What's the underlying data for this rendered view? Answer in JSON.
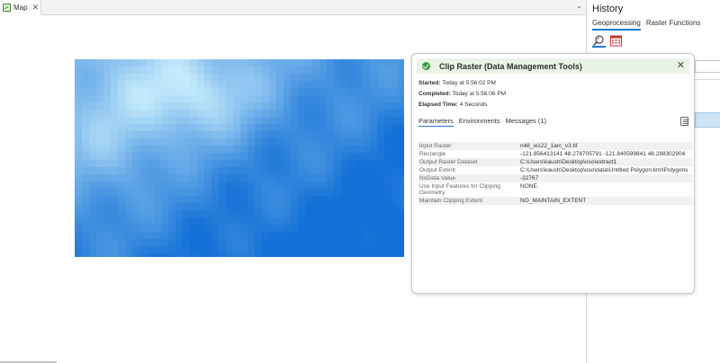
{
  "map_tab": {
    "label": "Map",
    "icon": "map-icon"
  },
  "history": {
    "title": "History",
    "tabs": [
      {
        "label": "Geoprocessing",
        "active": true
      },
      {
        "label": "Raster Functions",
        "active": false
      }
    ]
  },
  "popup": {
    "title": "Clip Raster (Data Management Tools)",
    "status_color": "#3a9a3a",
    "meta": {
      "started_label": "Started:",
      "started_value": "Today at 5:56:02 PM",
      "completed_label": "Completed:",
      "completed_value": "Today at 5:56:06 PM",
      "elapsed_label": "Elapsed Time:",
      "elapsed_value": "4 Seconds"
    },
    "tabs": [
      {
        "label": "Parameters",
        "active": true
      },
      {
        "label": "Environments",
        "active": false
      },
      {
        "label": "Messages (1)",
        "active": false
      }
    ],
    "parameters": [
      {
        "name": "Input Raster",
        "value": "n48_w122_1arc_v3.tif"
      },
      {
        "name": "Rectangle",
        "value": "-121.856413141 48.278705791 -121.840599841 48.288302904"
      },
      {
        "name": "Output Raster Dataset",
        "value": "C:\\Users\\kaush\\Desktop\\oso\\extract1"
      },
      {
        "name": "Output Extent",
        "value": "C:\\Users\\kaush\\Desktop\\oso\\data\\Untitled Polygon.kml\\Polygons"
      },
      {
        "name": "NoData Value",
        "value": "-32767"
      },
      {
        "name": "Use Input Features for Clipping Geometry",
        "value": "NONE"
      },
      {
        "name": "Maintain Clipping Extent",
        "value": "NO_MAINTAIN_EXTENT"
      }
    ]
  },
  "colors": {
    "accent": "#1f78d1",
    "header_bg": "#eaf4e6"
  }
}
